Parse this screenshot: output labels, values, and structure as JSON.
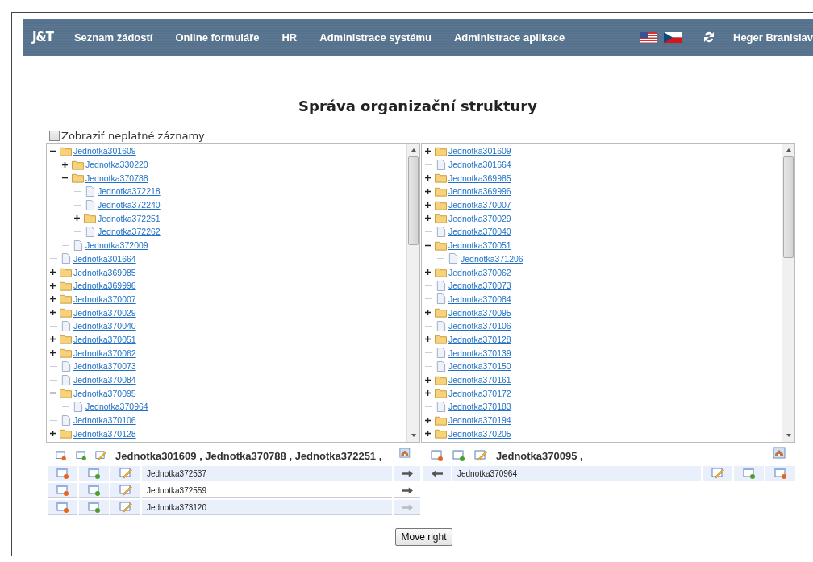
{
  "navbar": {
    "logo": "J&T",
    "menu": [
      {
        "label": "Seznam žádostí"
      },
      {
        "label": "Online formuláře"
      },
      {
        "label": "HR"
      },
      {
        "label": "Administrace systému"
      },
      {
        "label": "Administrace aplikace"
      }
    ],
    "user": "Heger Branislav"
  },
  "page_title": "Správa organizační struktury",
  "show_invalid": {
    "label": "Zobraziť neplatné záznamy",
    "checked": false
  },
  "left_tree": {
    "nodes": [
      {
        "label": "Jednotka301609",
        "kind": "folder",
        "expanded": true,
        "children": [
          {
            "label": "Jednotka330220",
            "kind": "folder",
            "expanded": false
          },
          {
            "label": "Jednotka370788",
            "kind": "folder",
            "expanded": true,
            "children": [
              {
                "label": "Jednotka372218",
                "kind": "file"
              },
              {
                "label": "Jednotka372240",
                "kind": "file"
              },
              {
                "label": "Jednotka372251",
                "kind": "folder",
                "expanded": false
              },
              {
                "label": "Jednotka372262",
                "kind": "file"
              }
            ]
          },
          {
            "label": "Jednotka372009",
            "kind": "file"
          }
        ]
      },
      {
        "label": "Jednotka301664",
        "kind": "file"
      },
      {
        "label": "Jednotka369985",
        "kind": "folder",
        "expanded": false
      },
      {
        "label": "Jednotka369996",
        "kind": "folder",
        "expanded": false
      },
      {
        "label": "Jednotka370007",
        "kind": "folder",
        "expanded": false
      },
      {
        "label": "Jednotka370029",
        "kind": "folder",
        "expanded": false
      },
      {
        "label": "Jednotka370040",
        "kind": "file"
      },
      {
        "label": "Jednotka370051",
        "kind": "folder",
        "expanded": false
      },
      {
        "label": "Jednotka370062",
        "kind": "folder",
        "expanded": false
      },
      {
        "label": "Jednotka370073",
        "kind": "file"
      },
      {
        "label": "Jednotka370084",
        "kind": "file"
      },
      {
        "label": "Jednotka370095",
        "kind": "folder",
        "expanded": true,
        "children": [
          {
            "label": "Jednotka370964",
            "kind": "file"
          }
        ]
      },
      {
        "label": "Jednotka370106",
        "kind": "file"
      },
      {
        "label": "Jednotka370128",
        "kind": "folder",
        "expanded": false
      }
    ]
  },
  "right_tree": {
    "nodes": [
      {
        "label": "Jednotka301609",
        "kind": "folder",
        "expanded": false
      },
      {
        "label": "Jednotka301664",
        "kind": "file"
      },
      {
        "label": "Jednotka369985",
        "kind": "folder",
        "expanded": false
      },
      {
        "label": "Jednotka369996",
        "kind": "folder",
        "expanded": false
      },
      {
        "label": "Jednotka370007",
        "kind": "folder",
        "expanded": false
      },
      {
        "label": "Jednotka370029",
        "kind": "folder",
        "expanded": false
      },
      {
        "label": "Jednotka370040",
        "kind": "file"
      },
      {
        "label": "Jednotka370051",
        "kind": "folder",
        "expanded": true,
        "children": [
          {
            "label": "Jednotka371206",
            "kind": "file"
          }
        ]
      },
      {
        "label": "Jednotka370062",
        "kind": "folder",
        "expanded": false
      },
      {
        "label": "Jednotka370073",
        "kind": "file"
      },
      {
        "label": "Jednotka370084",
        "kind": "file"
      },
      {
        "label": "Jednotka370095",
        "kind": "folder",
        "expanded": false
      },
      {
        "label": "Jednotka370106",
        "kind": "file"
      },
      {
        "label": "Jednotka370128",
        "kind": "folder",
        "expanded": false
      },
      {
        "label": "Jednotka370139",
        "kind": "file"
      },
      {
        "label": "Jednotka370150",
        "kind": "file"
      },
      {
        "label": "Jednotka370161",
        "kind": "folder",
        "expanded": false
      },
      {
        "label": "Jednotka370172",
        "kind": "folder",
        "expanded": false
      },
      {
        "label": "Jednotka370183",
        "kind": "file"
      },
      {
        "label": "Jednotka370194",
        "kind": "folder",
        "expanded": false
      },
      {
        "label": "Jednotka370205",
        "kind": "folder",
        "expanded": false
      }
    ]
  },
  "left_panel": {
    "path": "Jednotka301609 , Jednotka370788 , Jednotka372251 ,",
    "units": [
      {
        "name": "Jednotka372537",
        "disabled": false
      },
      {
        "name": "Jednotka372559",
        "disabled": false
      },
      {
        "name": "Jednotka373120",
        "disabled": true
      }
    ]
  },
  "right_panel": {
    "path": "Jednotka370095 ,",
    "units": [
      {
        "name": "Jednotka370964",
        "disabled": false
      }
    ]
  },
  "move_button": "Move right"
}
